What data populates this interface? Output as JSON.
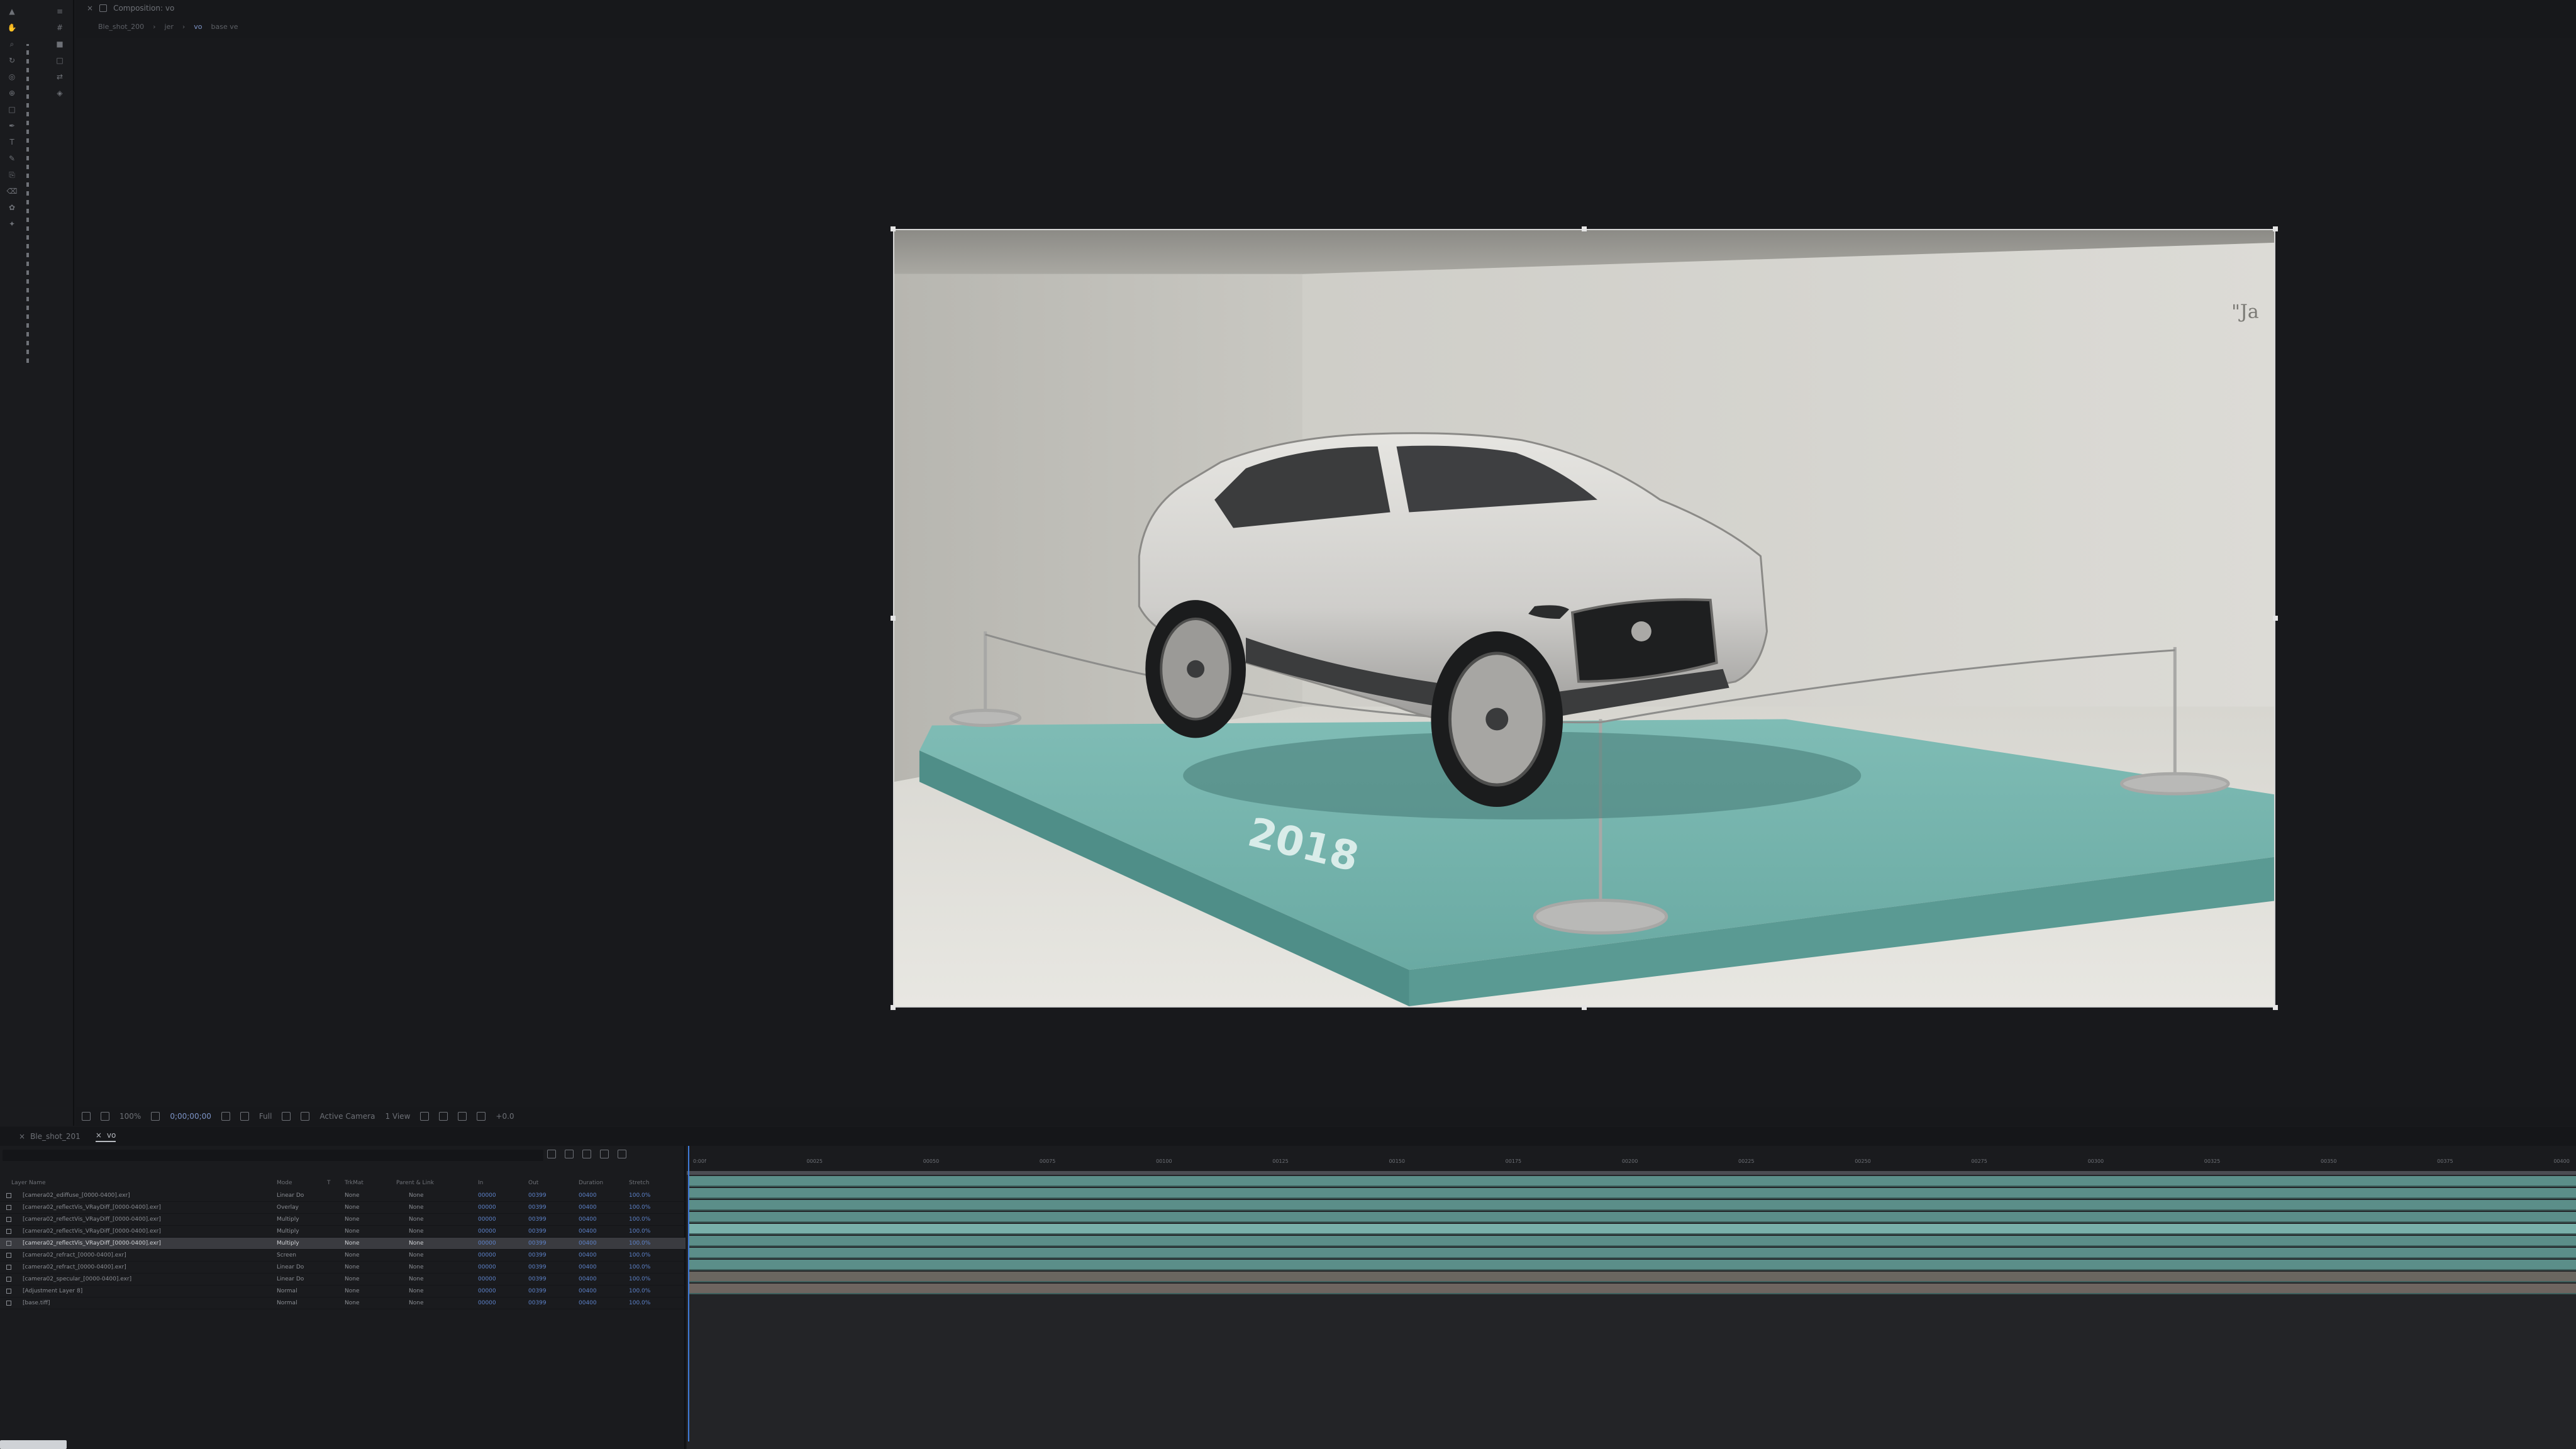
{
  "app": {
    "comp_tab_label": "Composition: vo",
    "breadcrumb": [
      "Ble_shot_200",
      "jer",
      "vo"
    ],
    "breadcrumb_extra": "base ve"
  },
  "viewer_footer": {
    "zoom": "100%",
    "timecode": "0;00;00;00",
    "resolution": "Full",
    "camera": "Active Camera",
    "views": "1 View",
    "exposure": "+0.0"
  },
  "timeline_tabs": [
    {
      "label": "Ble_shot_201",
      "active": false
    },
    {
      "label": "vo",
      "active": true
    }
  ],
  "layer_panel": {
    "search_placeholder": "",
    "columns": [
      "Layer Name",
      "Mode",
      "T",
      "TrkMat",
      "Parent & Link",
      "In",
      "Out",
      "Duration",
      "Stretch"
    ]
  },
  "layers": [
    {
      "name": "[camera02_ediffuse_[0000-0400].exr]",
      "mode": "Linear Do",
      "trkmat": "None",
      "parent": "None",
      "in": "00000",
      "out": "00399",
      "duration": "00400",
      "stretch": "100.0%"
    },
    {
      "name": "[camera02_reflectVis_VRayDiff_[0000-0400].exr]",
      "mode": "Overlay",
      "trkmat": "None",
      "parent": "None",
      "in": "00000",
      "out": "00399",
      "duration": "00400",
      "stretch": "100.0%"
    },
    {
      "name": "[camera02_reflectVis_VRayDiff_[0000-0400].exr]",
      "mode": "Multiply",
      "trkmat": "None",
      "parent": "None",
      "in": "00000",
      "out": "00399",
      "duration": "00400",
      "stretch": "100.0%"
    },
    {
      "name": "[camera02_reflectVis_VRayDiff_[0000-0400].exr]",
      "mode": "Multiply",
      "trkmat": "None",
      "parent": "None",
      "in": "00000",
      "out": "00399",
      "duration": "00400",
      "stretch": "100.0%"
    },
    {
      "name": "[camera02_reflectVis_VRayDiff_[0000-0400].exr]",
      "mode": "Multiply",
      "trkmat": "None",
      "parent": "None",
      "in": "00000",
      "out": "00399",
      "duration": "00400",
      "stretch": "100.0%",
      "selected": true
    },
    {
      "name": "[camera02_refract_[0000-0400].exr]",
      "mode": "Screen",
      "trkmat": "None",
      "parent": "None",
      "in": "00000",
      "out": "00399",
      "duration": "00400",
      "stretch": "100.0%"
    },
    {
      "name": "[camera02_refract_[0000-0400].exr]",
      "mode": "Linear Do",
      "trkmat": "None",
      "parent": "None",
      "in": "00000",
      "out": "00399",
      "duration": "00400",
      "stretch": "100.0%"
    },
    {
      "name": "[camera02_specular_[0000-0400].exr]",
      "mode": "Linear Do",
      "trkmat": "None",
      "parent": "None",
      "in": "00000",
      "out": "00399",
      "duration": "00400",
      "stretch": "100.0%"
    },
    {
      "name": "[Adjustment Layer 8]",
      "mode": "Normal",
      "trkmat": "None",
      "parent": "None",
      "in": "00000",
      "out": "00399",
      "duration": "00400",
      "stretch": "100.0%"
    },
    {
      "name": "[base.tiff]",
      "mode": "Normal",
      "trkmat": "None",
      "parent": "None",
      "in": "00000",
      "out": "00399",
      "duration": "00400",
      "stretch": "100.0%"
    }
  ],
  "ruler_ticks": [
    "0:00f",
    "00025",
    "00050",
    "00075",
    "00100",
    "00125",
    "00150",
    "00175",
    "00200",
    "00225",
    "00250",
    "00275",
    "00300",
    "00325",
    "00350",
    "00375",
    "00400"
  ],
  "render": {
    "podium_text": "2018",
    "wall_text": "\"Ja"
  },
  "colors": {
    "accent": "#3f7ad8",
    "track": "#5b8e89",
    "track_selected": "#79b0aa",
    "podium": "#6fb0aa"
  }
}
